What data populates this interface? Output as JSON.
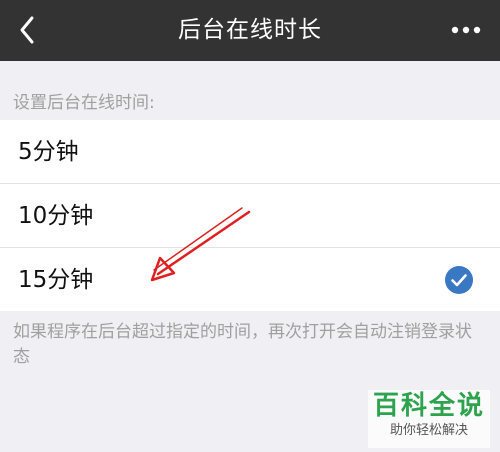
{
  "nav": {
    "title": "后台在线时长",
    "back_icon": "chevron-left-icon",
    "more_icon": "more-horizontal-icon"
  },
  "section": {
    "header": "设置后台在线时间:"
  },
  "options": [
    {
      "label": "5分钟",
      "selected": false
    },
    {
      "label": "10分钟",
      "selected": false
    },
    {
      "label": "15分钟",
      "selected": true
    }
  ],
  "footnote": "如果程序在后台超过指定的时间，再次打开会自动注销登录状态",
  "watermark": {
    "main": "百科全说",
    "sub": "助你轻松解决"
  },
  "colors": {
    "nav_bg": "#333333",
    "page_bg": "#efeff4",
    "check": "#3a78c4",
    "arrow": "#e02020",
    "watermark": "#2ea34e"
  }
}
